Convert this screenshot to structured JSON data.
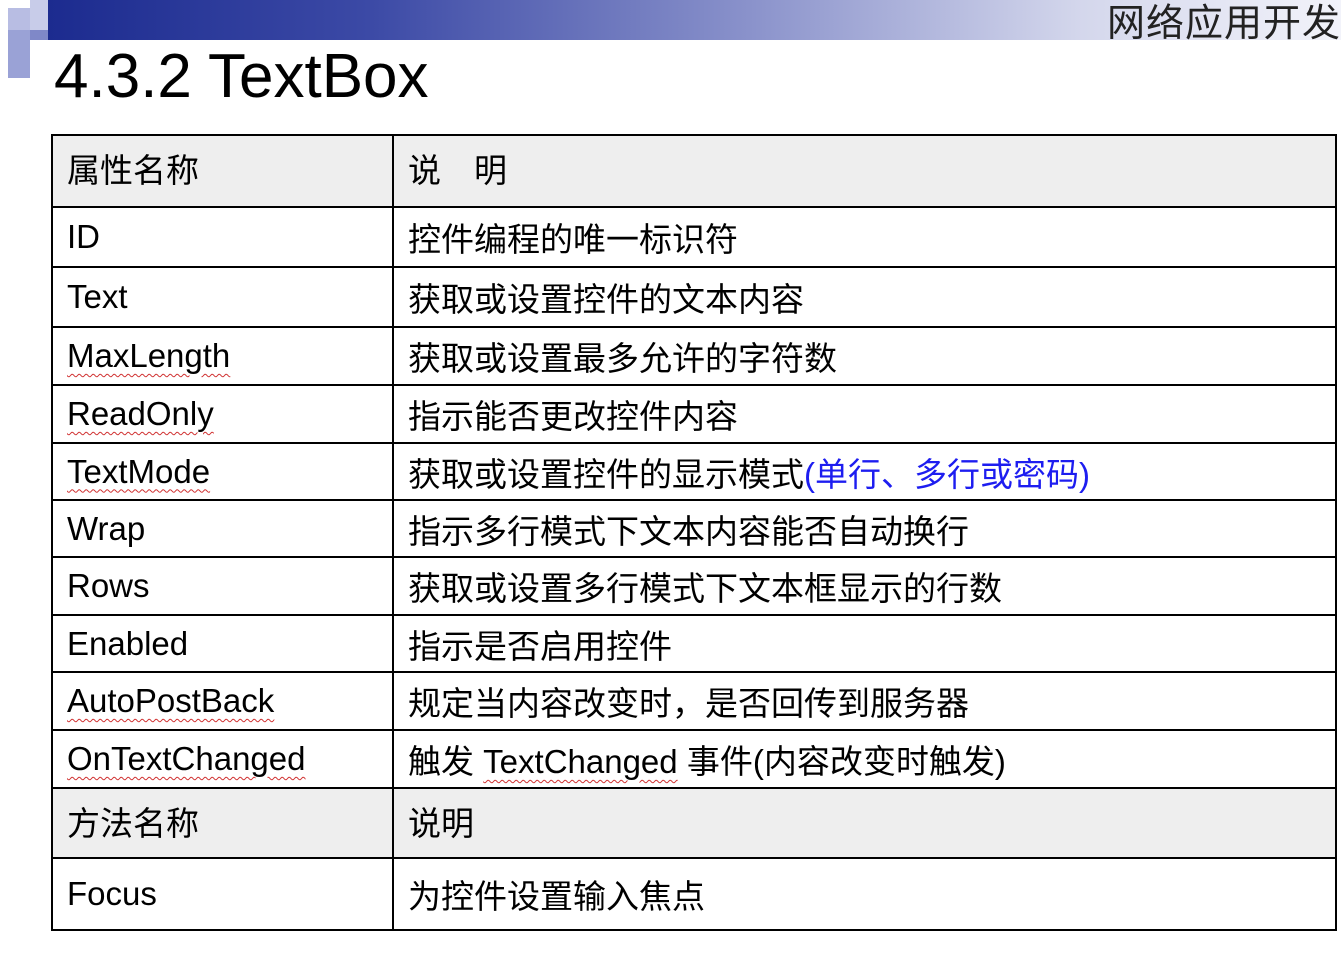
{
  "header": {
    "course_title": "网络应用开发"
  },
  "slide_title": "4.3.2 TextBox",
  "table": {
    "property_header": {
      "name": "属性名称",
      "desc": "说　明"
    },
    "properties": [
      {
        "name": "ID",
        "desc": "控件编程的唯一标识符",
        "name_color": "#ff0000"
      },
      {
        "name": "Text",
        "desc": "获取或设置控件的文本内容",
        "name_color": "#ff0000"
      },
      {
        "name": "MaxLength",
        "desc": "获取或设置最多允许的字符数",
        "name_color": "#ff0000"
      },
      {
        "name": "ReadOnly",
        "desc": "指示能否更改控件内容"
      },
      {
        "name": "TextMode",
        "desc": "获取或设置控件的显示模式",
        "desc_extra": "(单行、多行或密码)",
        "name_color": "#ff0000",
        "extra_color": "#1d1df0"
      },
      {
        "name": "Wrap",
        "desc": "指示多行模式下文本内容能否自动换行"
      },
      {
        "name": "Rows",
        "desc": "获取或设置多行模式下文本框显示的行数"
      },
      {
        "name": "Enabled",
        "desc": "指示是否启用控件"
      },
      {
        "name": "AutoPostBack",
        "desc": "规定当内容改变时，是否回传到服务器",
        "name_color": "#ff0000",
        "desc_color": "#ff0000"
      },
      {
        "name": "OnTextChanged",
        "desc_pre": "触发 ",
        "desc_link": "TextChanged",
        "desc_post": " 事件(内容改变时触发)"
      }
    ],
    "method_header": {
      "name": "方法名称",
      "desc": "说明"
    },
    "methods": [
      {
        "name": "Focus",
        "desc": "为控件设置输入焦点"
      }
    ]
  }
}
